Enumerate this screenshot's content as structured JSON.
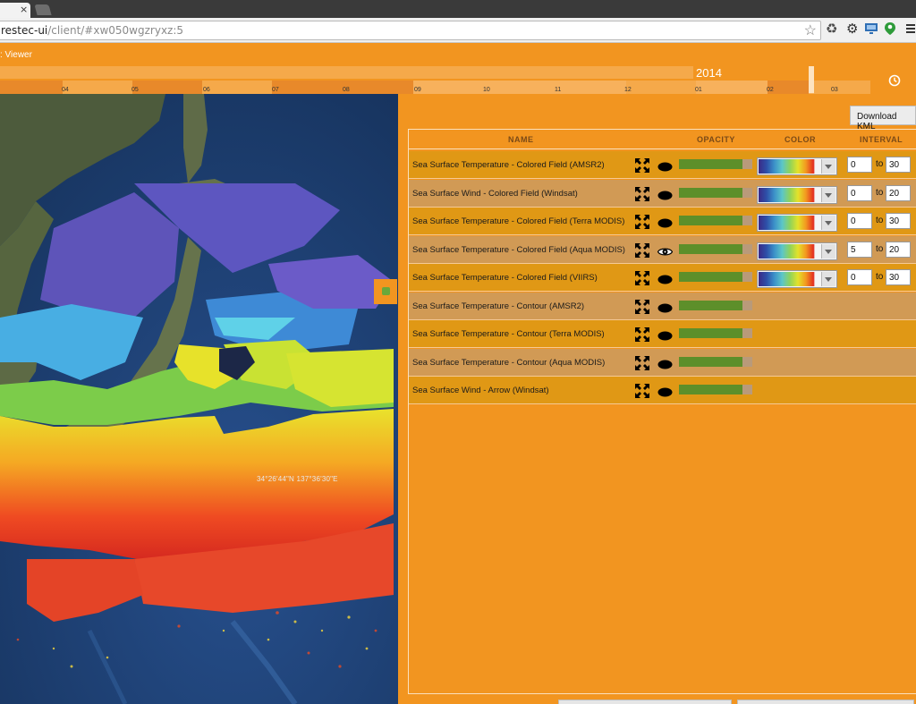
{
  "browser": {
    "tab_close": "×",
    "url_host": "restec-ui",
    "url_path": "/client/#xw050wgzryxz:5",
    "star": "☆",
    "extensions": [
      "recycle-icon",
      "gear-icon",
      "screen-icon",
      "map-pin-icon",
      "menu-icon"
    ]
  },
  "app": {
    "title": ": Viewer"
  },
  "timeline": {
    "year": "2014",
    "months": [
      "04",
      "05",
      "06",
      "07",
      "08",
      "09",
      "10",
      "11",
      "12",
      "01",
      "02",
      "03"
    ]
  },
  "map": {
    "coordinates": "34°26'44\"N 137°36'30\"E"
  },
  "panel": {
    "download_label": "Download KML",
    "headers": {
      "name": "NAME",
      "opacity": "OPACITY",
      "color": "COLOR",
      "interval": "INTERVAL"
    },
    "interval_sep": "to",
    "layers": [
      {
        "name": "Sea Surface Temperature - Colored Field (AMSR2)",
        "visible": false,
        "opacity": 0.86,
        "has_color": true,
        "min": "0",
        "max": "30"
      },
      {
        "name": "Sea Surface Wind - Colored Field (Windsat)",
        "visible": false,
        "opacity": 0.86,
        "has_color": true,
        "min": "0",
        "max": "20"
      },
      {
        "name": "Sea Surface Temperature - Colored Field (Terra MODIS)",
        "visible": false,
        "opacity": 0.86,
        "has_color": true,
        "min": "0",
        "max": "30"
      },
      {
        "name": "Sea Surface Temperature - Colored Field (Aqua MODIS)",
        "visible": true,
        "opacity": 0.86,
        "has_color": true,
        "min": "5",
        "max": "20"
      },
      {
        "name": "Sea Surface Temperature - Colored Field (VIIRS)",
        "visible": false,
        "opacity": 0.86,
        "has_color": true,
        "min": "0",
        "max": "30"
      },
      {
        "name": "Sea Surface Temperature - Contour (AMSR2)",
        "visible": false,
        "opacity": 0.86,
        "has_color": false
      },
      {
        "name": "Sea Surface Temperature - Contour (Terra MODIS)",
        "visible": false,
        "opacity": 0.86,
        "has_color": false
      },
      {
        "name": "Sea Surface Temperature - Contour (Aqua MODIS)",
        "visible": false,
        "opacity": 0.86,
        "has_color": false
      },
      {
        "name": "Sea Surface Wind - Arrow (Windsat)",
        "visible": false,
        "opacity": 0.86,
        "has_color": false
      }
    ]
  }
}
